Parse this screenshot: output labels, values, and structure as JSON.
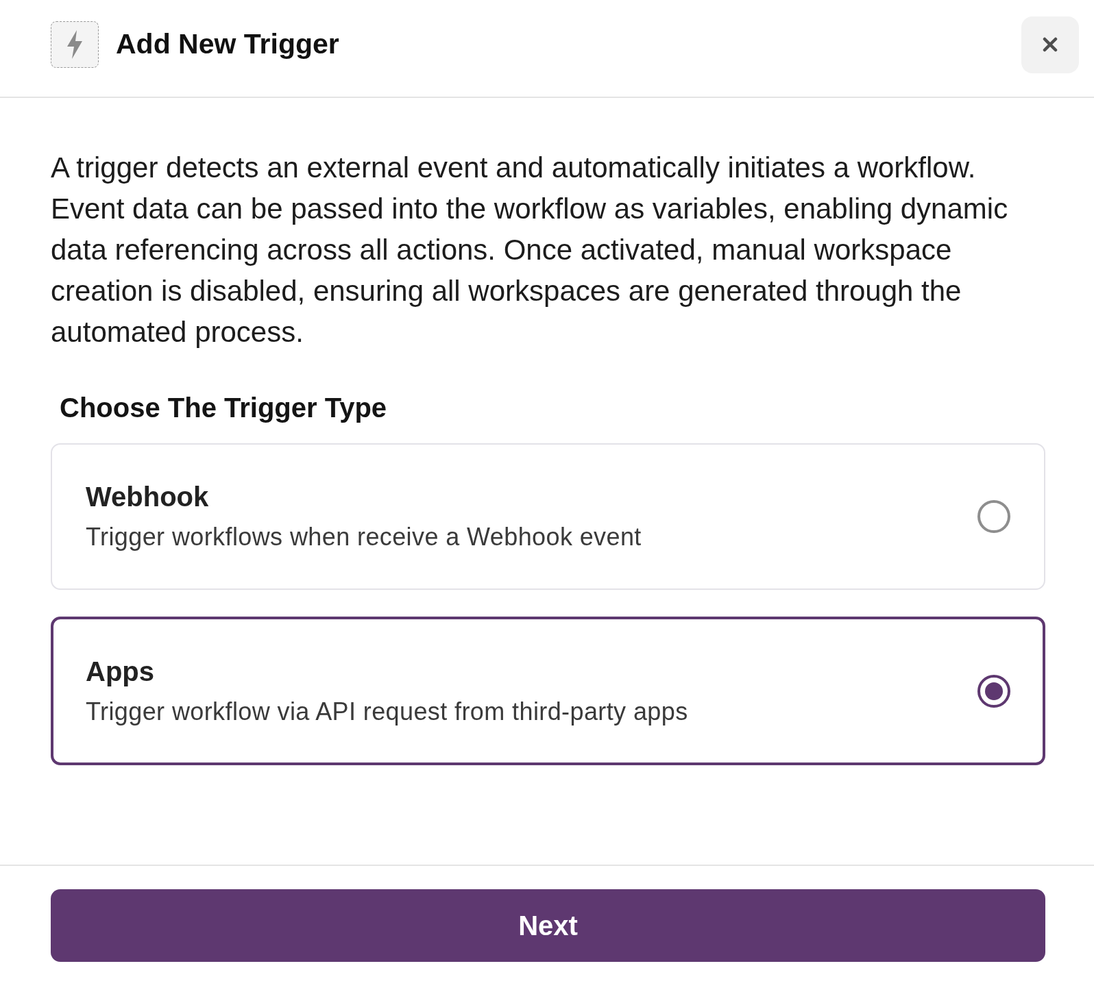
{
  "dialog": {
    "title": "Add New Trigger",
    "description": "A trigger detects an external event and automatically initiates a workflow. Event data can be passed into the workflow as variables, enabling dynamic data referencing across all actions. Once activated, manual workspace creation is disabled, ensuring all workspaces are generated through the automated process.",
    "section_title": "Choose The Trigger Type"
  },
  "trigger_types": [
    {
      "title": "Webhook",
      "description": "Trigger workflows when receive a Webhook event",
      "selected": false
    },
    {
      "title": "Apps",
      "description": "Trigger workflow via API request from third-party apps",
      "selected": true
    }
  ],
  "footer": {
    "next_button": "Next"
  }
}
